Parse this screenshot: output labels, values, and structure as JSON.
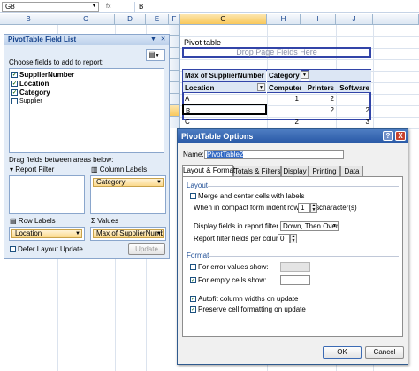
{
  "formula_bar": {
    "name_box": "G8",
    "fx_label": "fx",
    "value": "B"
  },
  "columns": [
    "B",
    "C",
    "D",
    "E",
    "F",
    "G",
    "H",
    "I",
    "J"
  ],
  "pivot": {
    "title": "Pivot table",
    "drop_hint": "Drop Page Fields Here",
    "value_field": "Max of SupplierNumber",
    "column_field": "Category",
    "row_field": "Location",
    "col_headers": [
      "Computers",
      "Printers",
      "Software"
    ],
    "rows": [
      {
        "label": "A",
        "values": [
          "1",
          "2",
          ""
        ]
      },
      {
        "label": "B",
        "values": [
          "",
          "2",
          "2"
        ]
      },
      {
        "label": "C",
        "values": [
          "2",
          "",
          "3"
        ]
      }
    ]
  },
  "field_list": {
    "title": "PivotTable Field List",
    "choose_label": "Choose fields to add to report:",
    "fields": [
      {
        "label": "SupplierNumber",
        "checked": true
      },
      {
        "label": "Location",
        "checked": true
      },
      {
        "label": "Category",
        "checked": true
      },
      {
        "label": "Supplier",
        "checked": false
      }
    ],
    "drag_label": "Drag fields between areas below:",
    "report_filter_label": "Report Filter",
    "column_labels_label": "Column Labels",
    "column_labels_chip": "Category",
    "row_labels_label": "Row Labels",
    "values_label": "Values",
    "row_labels_chip": "Location",
    "values_chip": "Max of SupplierNumber",
    "defer_label": "Defer Layout Update",
    "update_button": "Update"
  },
  "dialog": {
    "title": "PivotTable Options",
    "name_label": "Name:",
    "name_value": "PivotTable2",
    "tabs": [
      "Layout & Format",
      "Totals & Filters",
      "Display",
      "Printing",
      "Data"
    ],
    "layout_section": "Layout",
    "merge_label": "Merge and center cells with labels",
    "indent_prefix": "When in compact form indent row labels:",
    "indent_value": "1",
    "indent_suffix": "character(s)",
    "display_fields_label": "Display fields in report filter area:",
    "display_fields_value": "Down, Then Over",
    "report_filter_label": "Report filter fields per column:",
    "report_filter_value": "0",
    "format_section": "Format",
    "error_label": "For error values show:",
    "empty_label": "For empty cells show:",
    "autofit_label": "Autofit column widths on update",
    "preserve_label": "Preserve cell formatting on update",
    "ok_button": "OK",
    "cancel_button": "Cancel",
    "help_button": "?",
    "close_button": "X"
  }
}
